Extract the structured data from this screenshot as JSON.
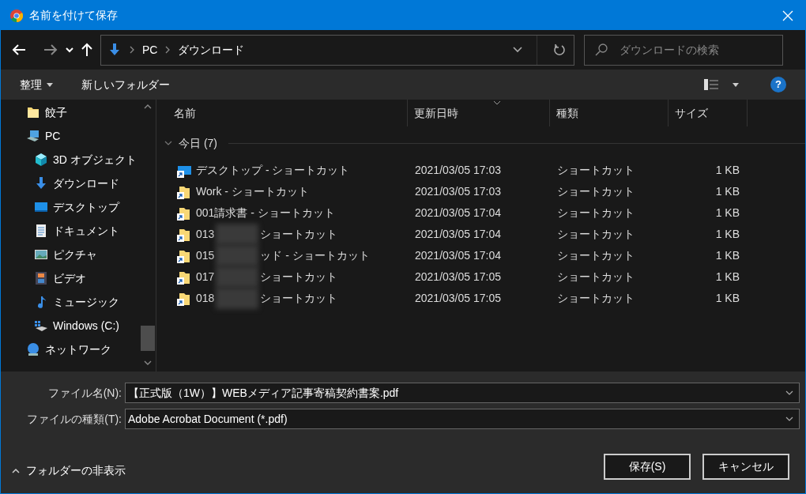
{
  "window": {
    "title": "名前を付けて保存"
  },
  "address_bar": {
    "path": [
      "PC",
      "ダウンロード"
    ]
  },
  "search": {
    "placeholder": "ダウンロードの検索"
  },
  "toolbar": {
    "organize": "整理",
    "new_folder": "新しいフォルダー",
    "help": "?"
  },
  "sidebar": {
    "items": [
      {
        "label": "餃子",
        "kind": "folder"
      },
      {
        "label": "PC",
        "kind": "pc",
        "children": [
          {
            "label": "3D オブジェクト",
            "kind": "cube"
          },
          {
            "label": "ダウンロード",
            "kind": "download"
          },
          {
            "label": "デスクトップ",
            "kind": "desktop"
          },
          {
            "label": "ドキュメント",
            "kind": "document"
          },
          {
            "label": "ピクチャ",
            "kind": "picture"
          },
          {
            "label": "ビデオ",
            "kind": "video"
          },
          {
            "label": "ミュージック",
            "kind": "music"
          },
          {
            "label": "Windows (C:)",
            "kind": "drive"
          }
        ]
      },
      {
        "label": "ネットワーク",
        "kind": "network"
      }
    ]
  },
  "table": {
    "columns": [
      "名前",
      "更新日時",
      "種類",
      "サイズ"
    ],
    "group": {
      "label": "今日 (7)",
      "expanded": true
    },
    "rows": [
      {
        "kind": "desktop",
        "name": "デスクトップ - ショートカット",
        "date": "2021/03/05 17:03",
        "type": "ショートカット",
        "size": "1 KB"
      },
      {
        "kind": "folder",
        "name": "Work - ショートカット",
        "date": "2021/03/05 17:03",
        "type": "ショートカット",
        "size": "1 KB"
      },
      {
        "kind": "folder",
        "name": "001請求書 - ショートカット",
        "date": "2021/03/05 17:04",
        "type": "ショートカット",
        "size": "1 KB"
      },
      {
        "kind": "folder",
        "name_start": "013",
        "name_end": "ショートカット",
        "date": "2021/03/05 17:04",
        "type": "ショートカット",
        "size": "1 KB"
      },
      {
        "kind": "folder",
        "name_start": "015",
        "name_end": "ッド - ショートカット",
        "date": "2021/03/05 17:04",
        "type": "ショートカット",
        "size": "1 KB"
      },
      {
        "kind": "folder",
        "name_start": "017",
        "name_end": "ショートカット",
        "date": "2021/03/05 17:05",
        "type": "ショートカット",
        "size": "1 KB"
      },
      {
        "kind": "folder",
        "name_start": "018",
        "name_end": "ショートカット",
        "date": "2021/03/05 17:05",
        "type": "ショートカット",
        "size": "1 KB"
      }
    ]
  },
  "file_name": {
    "label": "ファイル名(N):",
    "value": "【正式版（1W）】WEBメディア記事寄稿契約書案.pdf"
  },
  "file_type": {
    "label": "ファイルの種類(T):",
    "value": "Adobe Acrobat Document (*.pdf)"
  },
  "hide_folders": "フォルダーの非表示",
  "buttons": [
    "保存(S)",
    "キャンセル"
  ]
}
